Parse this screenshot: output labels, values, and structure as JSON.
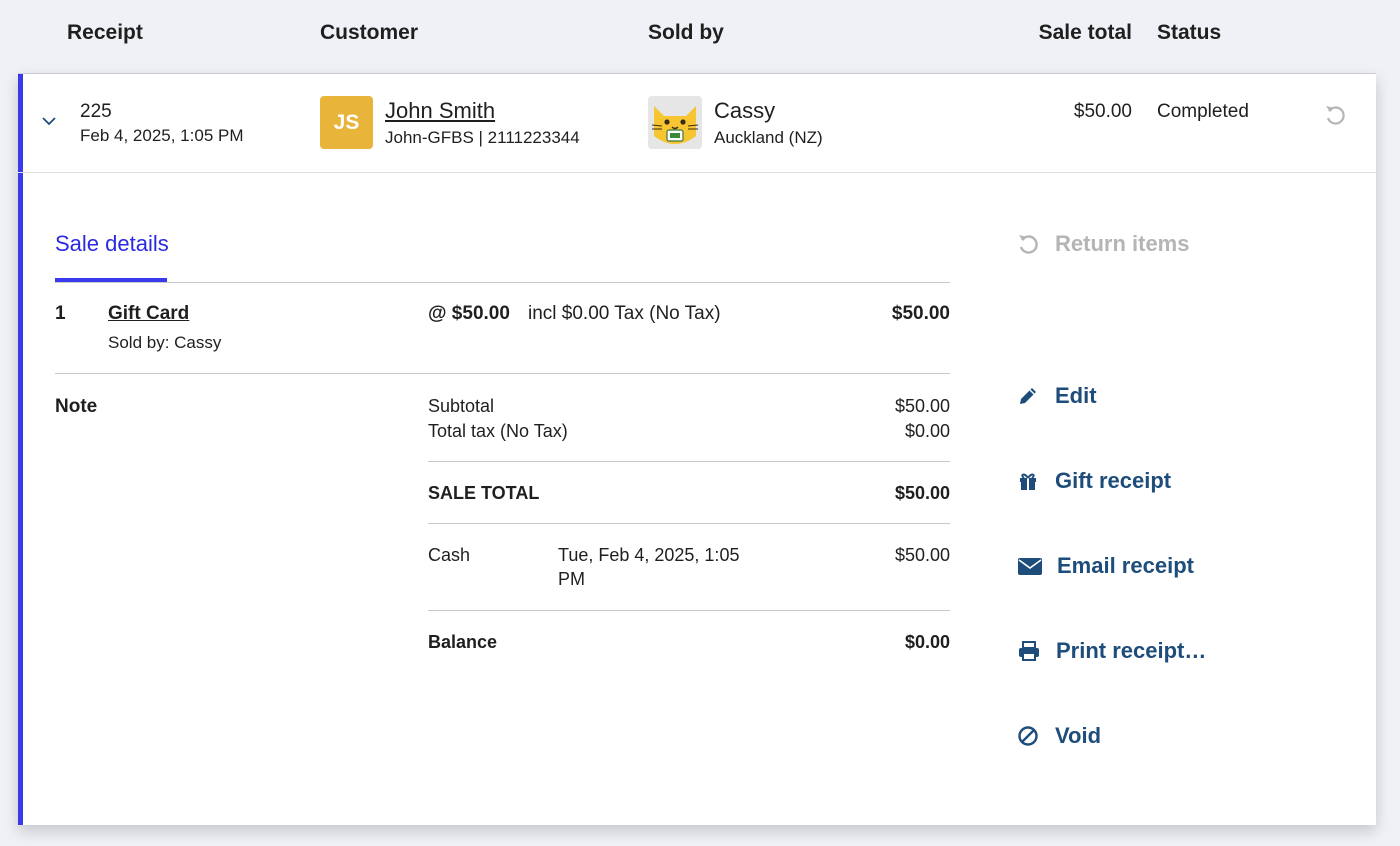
{
  "header": {
    "receipt": "Receipt",
    "customer": "Customer",
    "sold_by": "Sold by",
    "sale_total": "Sale total",
    "status": "Status"
  },
  "row": {
    "receipt_number": "225",
    "receipt_date": "Feb 4, 2025, 1:05 PM",
    "customer_initials": "JS",
    "customer_name": "John Smith",
    "customer_detail": "John-GFBS | 2111223344",
    "seller_name": "Cassy",
    "seller_location": "Auckland (NZ)",
    "sale_total": "$50.00",
    "status": "Completed"
  },
  "details": {
    "tab_label": "Sale details",
    "line_item": {
      "qty": "1",
      "name": "Gift Card",
      "sold_by": "Sold by: Cassy",
      "unit_price": "@ $50.00",
      "tax_note": "incl $0.00 Tax (No Tax)",
      "line_total": "$50.00"
    },
    "note_label": "Note",
    "subtotal_label": "Subtotal",
    "subtotal_value": "$50.00",
    "tax_label": "Total tax (No Tax)",
    "tax_value": "$0.00",
    "sale_total_label": "SALE TOTAL",
    "sale_total_value": "$50.00",
    "payment": {
      "method": "Cash",
      "date_line1": "Tue, Feb 4, 2025, 1:05",
      "date_line2": "PM",
      "amount": "$50.00"
    },
    "balance_label": "Balance",
    "balance_value": "$0.00"
  },
  "actions": {
    "return_items": "Return items",
    "edit": "Edit",
    "gift_receipt": "Gift receipt",
    "email_receipt": "Email receipt",
    "print_receipt": "Print receipt…",
    "void": "Void"
  },
  "colors": {
    "accent": "#3a3aeb",
    "action": "#1e4d7b",
    "avatar": "#e9b43a",
    "disabled": "#b5b5b5"
  }
}
